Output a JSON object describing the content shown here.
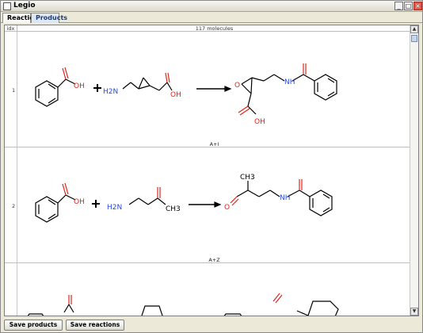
{
  "window": {
    "title": "Legio"
  },
  "tabs": [
    {
      "label": "Reaction",
      "active": false
    },
    {
      "label": "Products",
      "active": true
    }
  ],
  "table": {
    "header_idx": "idx",
    "header_molecules": "117 molecules"
  },
  "rows": [
    {
      "index": "1",
      "caption": "A+I",
      "labels": {
        "oh1": "OH",
        "nh2": "H2N",
        "oh2": "OH",
        "o_epox": "O",
        "nh": "NH",
        "oh3": "OH"
      }
    },
    {
      "index": "2",
      "caption": "A+Z",
      "labels": {
        "oh1": "OH",
        "nh2": "H2N",
        "ch3": "CH3",
        "o_ket": "O",
        "nh": "NH",
        "ch3b": "CH3"
      }
    },
    {
      "index": "3"
    }
  ],
  "buttons": {
    "save_products": "Save products",
    "save_reactions": "Save reactions"
  },
  "colors": {
    "oxygen": "#e0261b",
    "nitrogen": "#2b4bd8",
    "bond": "#000000",
    "accent_tab": "#dfe7f4"
  }
}
